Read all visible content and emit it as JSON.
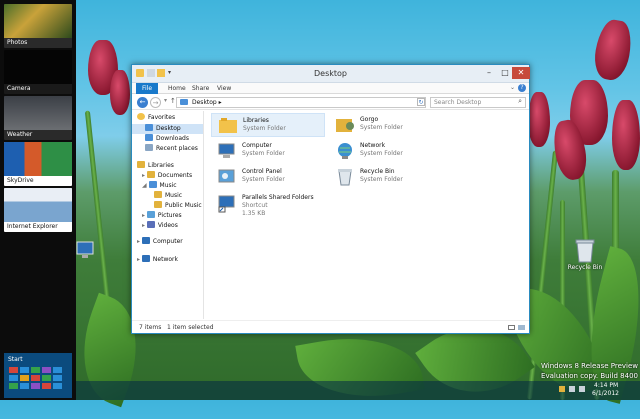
{
  "switcher": {
    "apps": [
      {
        "label": "Photos"
      },
      {
        "label": "Camera"
      },
      {
        "label": "Weather"
      },
      {
        "label": "SkyDrive"
      },
      {
        "label": "Internet Explorer"
      }
    ],
    "start_label": "Start"
  },
  "window": {
    "title": "Desktop",
    "ribbon_tabs": [
      "File",
      "Home",
      "Share",
      "View"
    ],
    "address": "Desktop",
    "search_placeholder": "Search Desktop",
    "nav": {
      "favorites": "Favorites",
      "desktop": "Desktop",
      "downloads": "Downloads",
      "recent": "Recent places",
      "libraries": "Libraries",
      "documents": "Documents",
      "music": "Music",
      "music_sub": "Music",
      "public_music": "Public Music",
      "pictures": "Pictures",
      "videos": "Videos",
      "computer": "Computer",
      "network": "Network"
    },
    "items": [
      {
        "name": "Libraries",
        "sub": "System Folder"
      },
      {
        "name": "Gorgo",
        "sub": "System Folder"
      },
      {
        "name": "Computer",
        "sub": "System Folder"
      },
      {
        "name": "Network",
        "sub": "System Folder"
      },
      {
        "name": "Control Panel",
        "sub": "System Folder"
      },
      {
        "name": "Recycle Bin",
        "sub": "System Folder"
      },
      {
        "name": "Parallels Shared Folders",
        "sub": "Shortcut",
        "size": "1.35 KB"
      }
    ],
    "status": {
      "count": "7 items",
      "selected": "1 item selected"
    }
  },
  "desktop": {
    "recycle_label": "Recycle Bin",
    "watermark_line1": "Windows 8 Release Preview",
    "watermark_line2": "Evaluation copy. Build 8400"
  },
  "taskbar": {
    "time": "4:14 PM",
    "date": "6/1/2012"
  },
  "colors": {
    "accent": "#1979ca",
    "start_bg": "#0b4b7e"
  }
}
